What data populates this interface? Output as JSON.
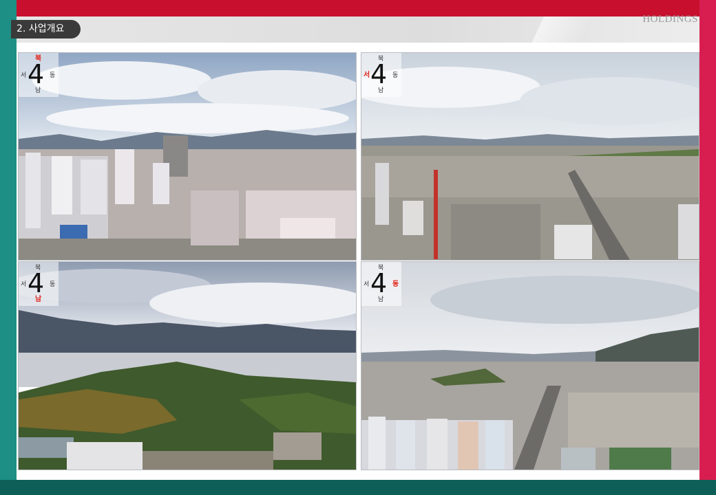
{
  "header": {
    "section_label": "2. 사업개요",
    "brand": "HOLDINGS"
  },
  "panels": [
    {
      "name": "view-north",
      "compass": {
        "digit": "4",
        "n": "북",
        "w": "서",
        "e": "동",
        "s": "남",
        "active": "n"
      }
    },
    {
      "name": "view-west",
      "compass": {
        "digit": "4",
        "n": "북",
        "w": "서",
        "e": "동",
        "s": "남",
        "active": "w"
      }
    },
    {
      "name": "view-south",
      "compass": {
        "digit": "4",
        "n": "북",
        "w": "서",
        "e": "동",
        "s": "남",
        "active": "s"
      }
    },
    {
      "name": "view-east",
      "compass": {
        "digit": "4",
        "n": "북",
        "w": "서",
        "e": "동",
        "s": "남",
        "active": "e"
      }
    }
  ],
  "colors": {
    "frame_top": "#c8102e",
    "frame_left": "#1d8f84",
    "frame_right": "#d81e50",
    "frame_bottom": "#0e5f57",
    "active_direction": "#e2231a"
  }
}
